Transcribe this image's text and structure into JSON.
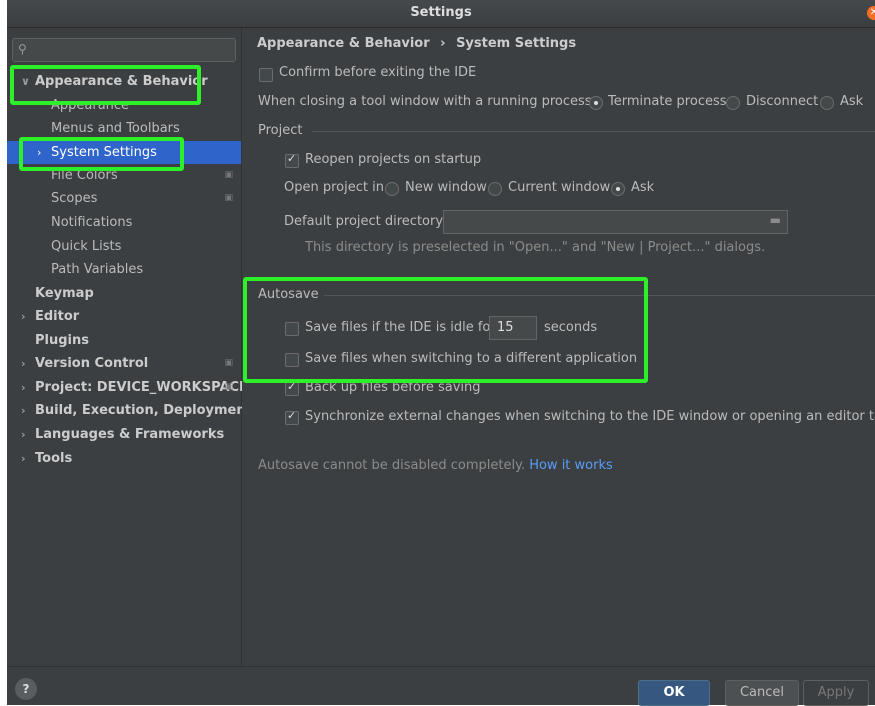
{
  "window": {
    "title": "Settings"
  },
  "sidebar": {
    "search_placeholder": "",
    "items": [
      {
        "label": "Appearance & Behavior",
        "arrow": "∨",
        "bold": true
      },
      {
        "label": "Appearance"
      },
      {
        "label": "Menus and Toolbars"
      },
      {
        "label": "System Settings",
        "arrow": "›",
        "selected": true
      },
      {
        "label": "File Colors",
        "copy_icon": true
      },
      {
        "label": "Scopes",
        "copy_icon": true
      },
      {
        "label": "Notifications"
      },
      {
        "label": "Quick Lists"
      },
      {
        "label": "Path Variables"
      },
      {
        "label": "Keymap",
        "bold": true
      },
      {
        "label": "Editor",
        "arrow": "›",
        "bold": true
      },
      {
        "label": "Plugins",
        "bold": true
      },
      {
        "label": "Version Control",
        "arrow": "›",
        "bold": true,
        "copy_icon": true
      },
      {
        "label": "Project: DEVICE_WORKSPACE",
        "arrow": "›",
        "bold": true,
        "copy_icon": true
      },
      {
        "label": "Build, Execution, Deployment",
        "arrow": "›",
        "bold": true
      },
      {
        "label": "Languages & Frameworks",
        "arrow": "›",
        "bold": true
      },
      {
        "label": "Tools",
        "arrow": "›",
        "bold": true
      }
    ]
  },
  "content": {
    "breadcrumb": {
      "parent": "Appearance & Behavior",
      "separator": "›",
      "current": "System Settings"
    },
    "confirm_exit": {
      "label": "Confirm before exiting the IDE",
      "checked": false
    },
    "closing_tool_window": {
      "label": "When closing a tool window with a running process:",
      "options": [
        "Terminate process",
        "Disconnect",
        "Ask"
      ],
      "selected": "Terminate process"
    },
    "project": {
      "section_label": "Project",
      "reopen": {
        "label": "Reopen projects on startup",
        "checked": true
      },
      "open_in": {
        "label": "Open project in",
        "options": [
          "New window",
          "Current window",
          "Ask"
        ],
        "selected": "Ask"
      },
      "default_dir": {
        "label": "Default project directory:",
        "value": "",
        "hint": "This directory is preselected in \"Open...\" and \"New | Project...\" dialogs."
      }
    },
    "autosave": {
      "section_label": "Autosave",
      "idle": {
        "label": "Save files if the IDE is idle for",
        "value": "15",
        "suffix": "seconds",
        "checked": false
      },
      "switching": {
        "label": "Save files when switching to a different application",
        "checked": false
      },
      "backup": {
        "label": "Back up files before saving",
        "checked": true
      },
      "sync": {
        "label": "Synchronize external changes when switching to the IDE window or opening an editor tab",
        "checked": true
      },
      "note": "Autosave cannot be disabled completely.",
      "link": "How it works"
    }
  },
  "buttons": {
    "help": "?",
    "ok": "OK",
    "cancel": "Cancel",
    "apply": "Apply"
  },
  "colors": {
    "accent": "#2f65ca",
    "highlight": "#2df028",
    "link": "#589df6"
  }
}
